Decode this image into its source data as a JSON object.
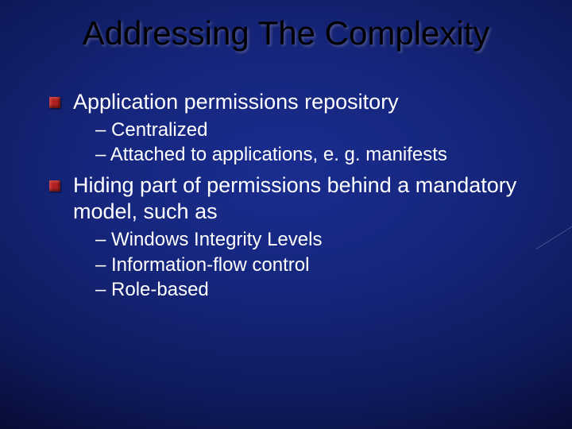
{
  "title": "Addressing The Complexity",
  "items": [
    {
      "text": "Application permissions repository",
      "sub": [
        "– Centralized",
        "– Attached to applications, e. g. manifests"
      ]
    },
    {
      "text": "Hiding part of permissions behind a mandatory model, such as",
      "sub": [
        "– Windows Integrity Levels",
        "– Information-flow control",
        "– Role-based"
      ]
    }
  ]
}
